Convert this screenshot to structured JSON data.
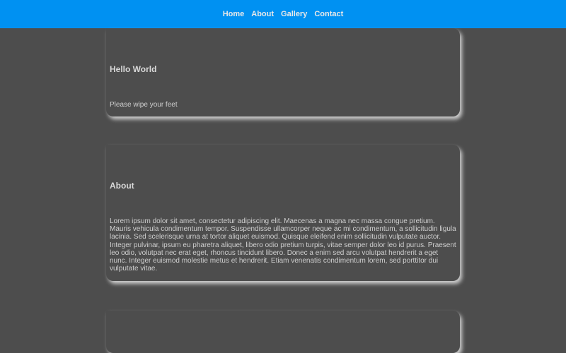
{
  "nav": {
    "items": [
      {
        "label": "Home"
      },
      {
        "label": "About"
      },
      {
        "label": "Gallery"
      },
      {
        "label": "Contact"
      }
    ]
  },
  "sections": [
    {
      "title": "Hello World",
      "text": "Please wipe your feet"
    },
    {
      "title": "About",
      "text": "Lorem ipsum dolor sit amet, consectetur adipiscing elit. Maecenas a magna nec massa congue pretium. Mauris vehicula condimentum tempor. Suspendisse ullamcorper neque ac mi condimentum, a sollicitudin ligula lacinia. Sed scelerisque urna at tortor aliquet euismod. Quisque eleifend enim sollicitudin vulputate auctor. Integer pulvinar, ipsum eu pharetra aliquet, libero odio pretium turpis, vitae semper dolor leo id purus. Praesent leo odio, volutpat nec erat eget, rhoncus tincidunt libero. Donec a enim sed arcu volutpat hendrerit a eget nunc. Integer euismod molestie metus et hendrerit. Etiam venenatis condimentum lorem, sed porttitor dui vulputate vitae."
    }
  ],
  "colors": {
    "header": "#0091f2",
    "background": "#4d4d4d"
  }
}
